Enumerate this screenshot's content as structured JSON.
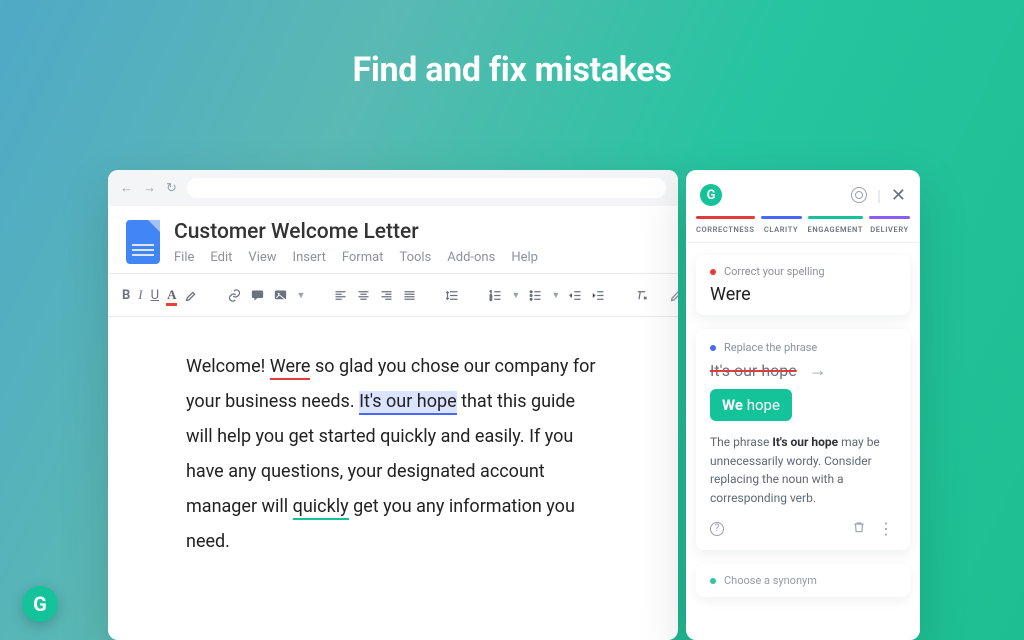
{
  "headline": "Find and fix mistakes",
  "doc": {
    "title": "Customer Welcome Letter",
    "menu": [
      "File",
      "Edit",
      "View",
      "Insert",
      "Format",
      "Tools",
      "Add-ons",
      "Help"
    ],
    "body": {
      "t1": "Welcome! ",
      "err_red": "Were",
      "t2": " so glad you chose our company for your business needs. ",
      "err_blue": "It's our hope",
      "t3": " that this guide will help you get started quickly and easily. If you have any questions, your designated account manager will ",
      "err_green": "quickly",
      "t4": " get you any information you need."
    }
  },
  "panel": {
    "tabs": [
      {
        "label": "CORRECTNESS",
        "color": "#e23b3b"
      },
      {
        "label": "CLARITY",
        "color": "#4b67f3"
      },
      {
        "label": "ENGAGEMENT",
        "color": "#15c39a"
      },
      {
        "label": "DELIVERY",
        "color": "#8b5cf6"
      }
    ],
    "card1": {
      "dot": "#e23b3b",
      "title": "Correct your spelling",
      "word": "Were"
    },
    "card2": {
      "dot": "#4b67f3",
      "title": "Replace the phrase",
      "strike": "It's our hope",
      "chip_bold": "We",
      "chip_rest": " hope",
      "desc_pre": "The phrase ",
      "desc_bold": "It's our hope",
      "desc_post": " may be unnecessarily wordy. Consider replacing the noun with a corresponding verb."
    },
    "card3": {
      "dot": "#15c39a",
      "title": "Choose a synonym"
    }
  }
}
